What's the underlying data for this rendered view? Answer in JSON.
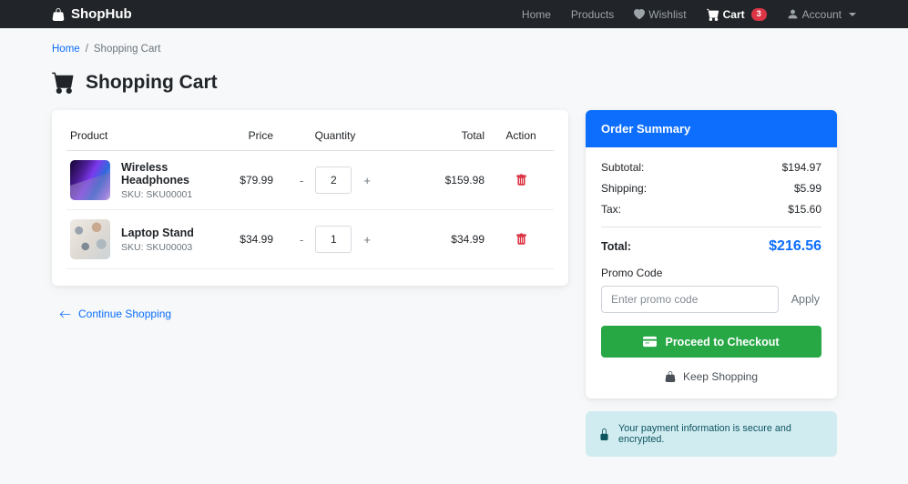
{
  "navbar": {
    "brand": "ShopHub",
    "items": [
      {
        "label": "Home"
      },
      {
        "label": "Products"
      },
      {
        "label": "Wishlist"
      },
      {
        "label": "Cart",
        "badge": "3"
      },
      {
        "label": "Account"
      }
    ]
  },
  "breadcrumb": {
    "home": "Home",
    "separator": "/",
    "current": "Shopping Cart"
  },
  "page": {
    "title": "Shopping Cart"
  },
  "cart_table": {
    "headers": {
      "product": "Product",
      "price": "Price",
      "quantity": "Quantity",
      "total": "Total",
      "action": "Action"
    },
    "minus": "-",
    "plus": "+",
    "rows": [
      {
        "name": "Wireless Headphones",
        "sku": "SKU: SKU00001",
        "price": "$79.99",
        "qty": "2",
        "total": "$159.98"
      },
      {
        "name": "Laptop Stand",
        "sku": "SKU: SKU00003",
        "price": "$34.99",
        "qty": "1",
        "total": "$34.99"
      }
    ]
  },
  "continue_shopping": "Continue Shopping",
  "order_summary": {
    "title": "Order Summary",
    "subtotal_label": "Subtotal:",
    "subtotal": "$194.97",
    "shipping_label": "Shipping:",
    "shipping": "$5.99",
    "tax_label": "Tax:",
    "tax": "$15.60",
    "total_label": "Total:",
    "total": "$216.56",
    "promo_label": "Promo Code",
    "promo_placeholder": "Enter promo code",
    "apply_label": "Apply",
    "checkout_label": "Proceed to Checkout",
    "keep_shopping_label": "Keep Shopping"
  },
  "security_notice": "Your payment information is secure and encrypted.",
  "colors": {
    "navbar_bg": "#212529",
    "primary_blue": "#0d6efd",
    "success_green": "#28a745",
    "danger_red": "#dc3545",
    "info_alert_bg": "#d1ecf1",
    "info_alert_text": "#0c5460",
    "page_bg": "#f6f8f9"
  }
}
